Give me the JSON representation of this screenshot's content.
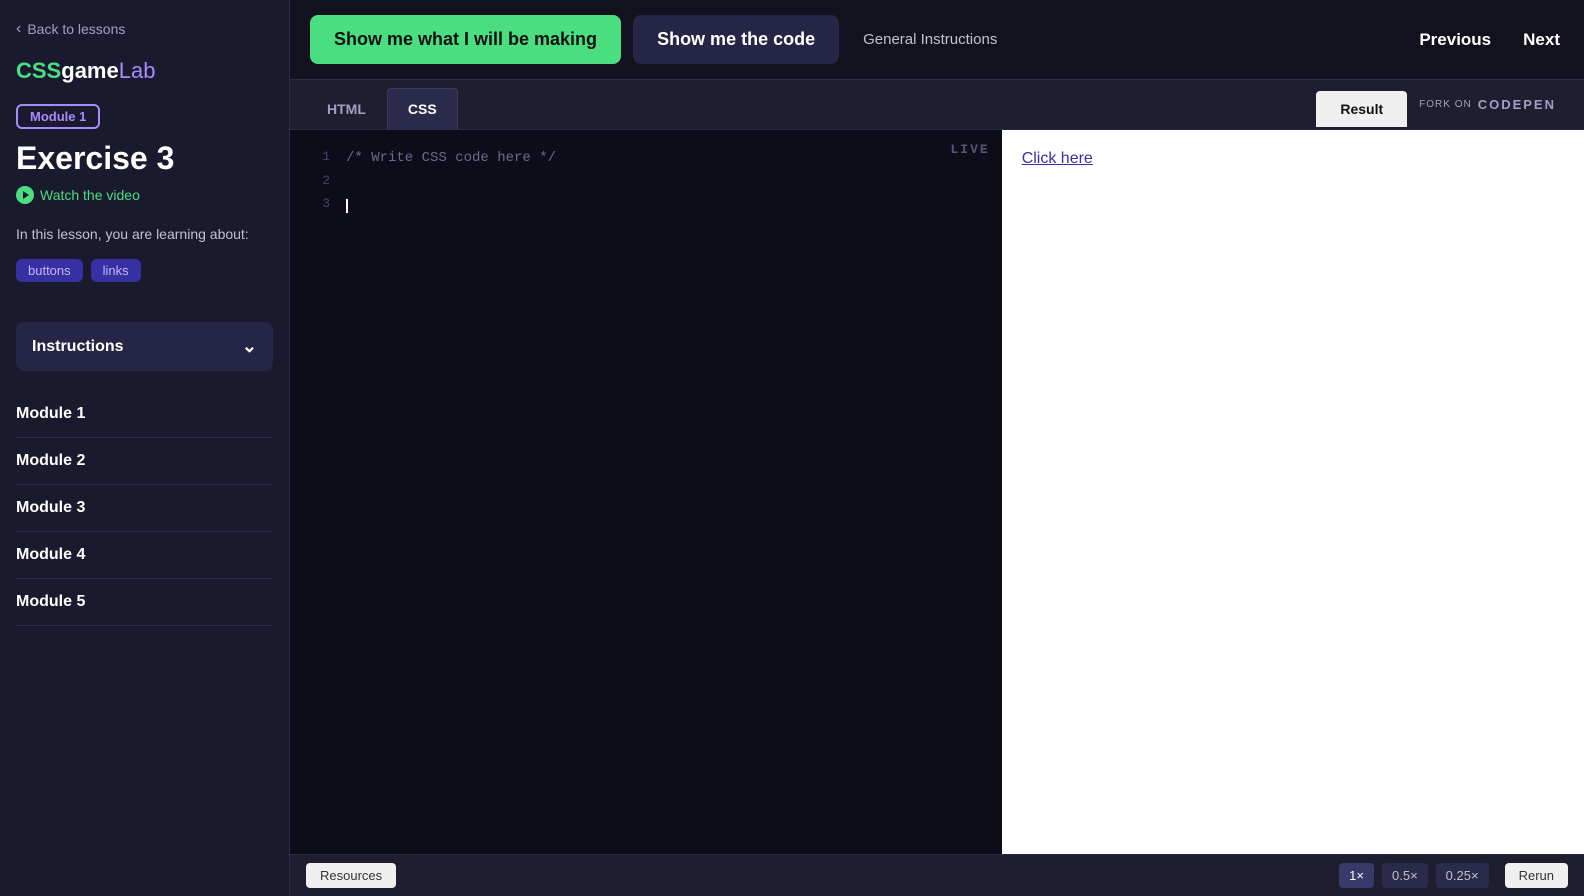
{
  "sidebar": {
    "back_label": "Back to lessons",
    "logo": {
      "css": "CSS",
      "game": "game",
      "lab": "Lab"
    },
    "module_badge": "Module 1",
    "exercise_title": "Exercise 3",
    "watch_video_label": "Watch the video",
    "learning_text": "In this lesson, you are learning about:",
    "tags": [
      "buttons",
      "links"
    ],
    "instructions_label": "Instructions",
    "modules": [
      "Module 1",
      "Module 2",
      "Module 3",
      "Module 4",
      "Module 5"
    ]
  },
  "topnav": {
    "show_making_label": "Show me what I will be making",
    "show_code_label": "Show me the code",
    "general_instructions_label": "General Instructions",
    "previous_label": "Previous",
    "next_label": "Next"
  },
  "editor": {
    "tabs": [
      {
        "id": "html",
        "label": "HTML",
        "active": false
      },
      {
        "id": "css",
        "label": "CSS",
        "active": true
      }
    ],
    "result_label": "Result",
    "fork_on_label": "FORK ON",
    "codepen_label": "CODEPEN",
    "live_label": "LIVE",
    "code_lines": [
      {
        "num": "1",
        "content": "/* Write CSS code here */"
      },
      {
        "num": "2",
        "content": ""
      },
      {
        "num": "3",
        "content": ""
      }
    ]
  },
  "preview": {
    "link_text": "Click here"
  },
  "bottombar": {
    "resources_label": "Resources",
    "zoom_1x": "1×",
    "zoom_05x": "0.5×",
    "zoom_025x": "0.25×",
    "rerun_label": "Rerun"
  }
}
